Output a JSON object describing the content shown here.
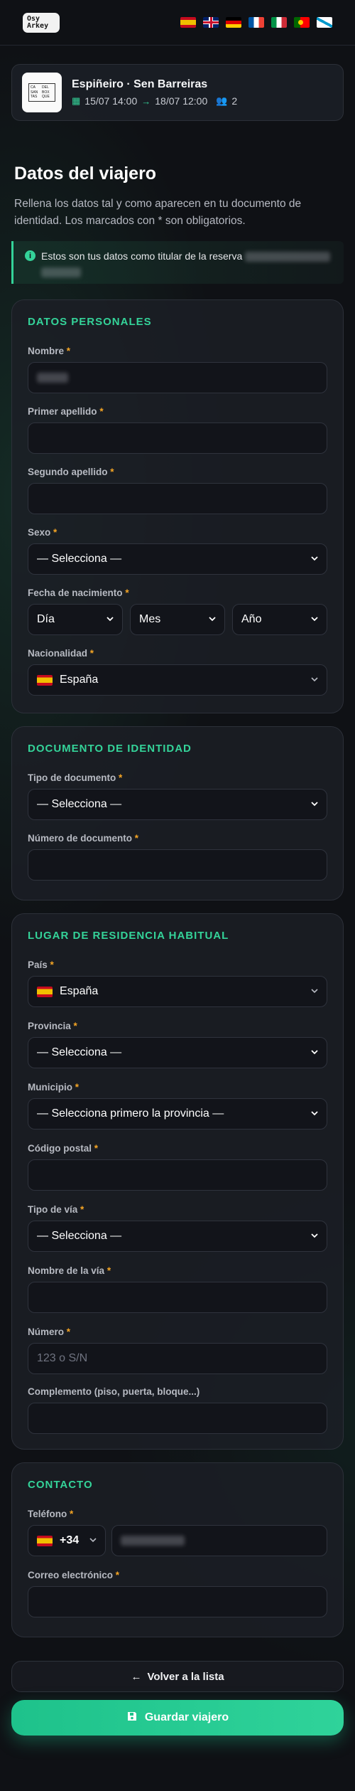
{
  "header": {
    "logo_line1": "Osy",
    "logo_line2": "Arkey",
    "languages": [
      {
        "code": "es",
        "icon": "flag-es"
      },
      {
        "code": "en",
        "icon": "flag-gb"
      },
      {
        "code": "de",
        "icon": "flag-de"
      },
      {
        "code": "fr",
        "icon": "flag-fr"
      },
      {
        "code": "it",
        "icon": "flag-it"
      },
      {
        "code": "pt",
        "icon": "flag-pt"
      },
      {
        "code": "gl",
        "icon": "flag-gl"
      }
    ]
  },
  "booking": {
    "property_name": "Espiñeiro · Sen Barreiras",
    "checkin": "15/07 14:00",
    "checkout": "18/07 12:00",
    "guests": "2",
    "logo_text": [
      "CA",
      "DEL",
      "SAN",
      "BOX",
      "TAS",
      "QUE"
    ]
  },
  "page": {
    "title": "Datos del viajero",
    "intro": "Rellena los datos tal y como aparecen en tu documento de identidad. Los marcados con * son obligatorios.",
    "notice": "Estos son tus datos como titular de la reserva"
  },
  "personal": {
    "title": "DATOS PERSONALES",
    "nombre_label": "Nombre",
    "apellido1_label": "Primer apellido",
    "apellido2_label": "Segundo apellido",
    "sexo_label": "Sexo",
    "sexo_value": "— Selecciona —",
    "nacimiento_label": "Fecha de nacimiento",
    "dia": "Día",
    "mes": "Mes",
    "anio": "Año",
    "nacionalidad_label": "Nacionalidad",
    "nacionalidad_value": "España"
  },
  "documento": {
    "title": "DOCUMENTO DE IDENTIDAD",
    "tipo_label": "Tipo de documento",
    "tipo_value": "— Selecciona —",
    "numero_label": "Número de documento"
  },
  "residencia": {
    "title": "LUGAR DE RESIDENCIA HABITUAL",
    "pais_label": "País",
    "pais_value": "España",
    "provincia_label": "Provincia",
    "provincia_value": "— Selecciona —",
    "municipio_label": "Municipio",
    "municipio_value": "— Selecciona primero la provincia —",
    "cp_label": "Código postal",
    "tipo_via_label": "Tipo de vía",
    "tipo_via_value": "— Selecciona —",
    "nombre_via_label": "Nombre de la vía",
    "numero_label": "Número",
    "numero_placeholder": "123 o S/N",
    "complemento_label": "Complemento (piso, puerta, bloque...)"
  },
  "contacto": {
    "title": "CONTACTO",
    "telefono_label": "Teléfono",
    "prefijo": "+34",
    "email_label": "Correo electrónico"
  },
  "actions": {
    "back": "Volver a la lista",
    "save": "Guardar viajero"
  },
  "colors": {
    "accent": "#34d399",
    "required": "#f5a524",
    "background": "#0f1115"
  }
}
